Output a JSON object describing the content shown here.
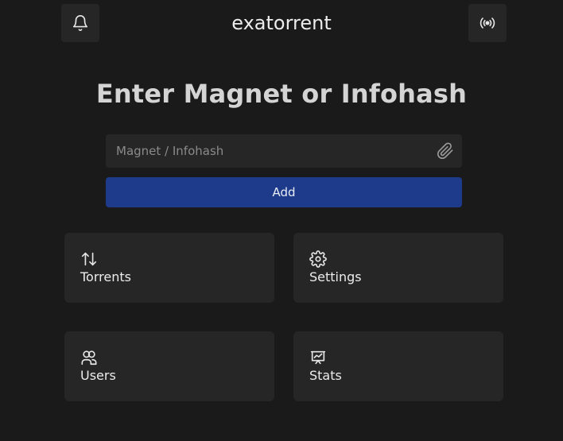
{
  "header": {
    "brand": "exatorrent",
    "left_icon": "bell-icon",
    "right_icon": "broadcast-icon"
  },
  "main": {
    "headline": "Enter Magnet or Infohash",
    "input": {
      "placeholder": "Magnet / Infohash",
      "value": "",
      "attach_icon": "paperclip-icon"
    },
    "add_label": "Add"
  },
  "cards": [
    {
      "label": "Torrents",
      "icon": "arrows-up-down-icon"
    },
    {
      "label": "Settings",
      "icon": "gear-icon"
    },
    {
      "label": "Users",
      "icon": "users-icon"
    },
    {
      "label": "Stats",
      "icon": "chart-presentation-icon"
    }
  ],
  "colors": {
    "background": "#1a1a1a",
    "surface": "#262626",
    "accent": "#1e3a8a",
    "text": "#e6e6e6"
  }
}
